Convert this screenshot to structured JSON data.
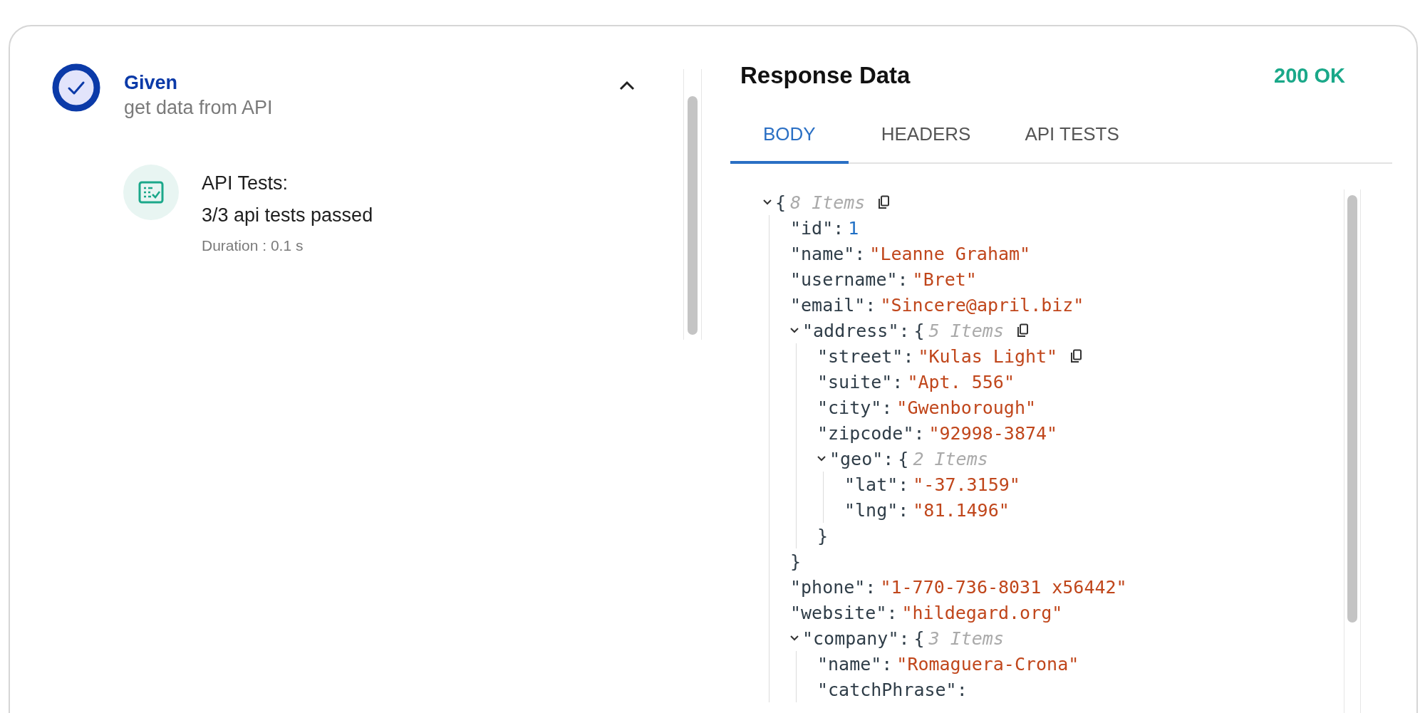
{
  "step": {
    "passed": true,
    "title": "Given",
    "subtitle": "get data from API",
    "expanded": true
  },
  "result": {
    "title": "API Tests:",
    "summary": "3/3 api tests passed",
    "duration": "Duration : 0.1 s"
  },
  "response": {
    "title": "Response Data",
    "status": "200 OK",
    "tabs": [
      {
        "label": "BODY",
        "selected": true
      },
      {
        "label": "HEADERS",
        "selected": false
      },
      {
        "label": "API TESTS",
        "selected": false
      }
    ],
    "tree": {
      "kind": "object",
      "open": "{",
      "count": "8 Items",
      "copy": true,
      "expanded": true,
      "children": [
        {
          "kind": "number",
          "key": "\"id\":",
          "value": "1"
        },
        {
          "kind": "string",
          "key": "\"name\":",
          "value": "\"Leanne Graham\""
        },
        {
          "kind": "string",
          "key": "\"username\":",
          "value": "\"Bret\""
        },
        {
          "kind": "string",
          "key": "\"email\":",
          "value": "\"Sincere@april.biz\""
        },
        {
          "kind": "object",
          "key": "\"address\":",
          "open": "{",
          "count": "5 Items",
          "copy": true,
          "expanded": true,
          "close": "}",
          "children": [
            {
              "kind": "string",
              "key": "\"street\":",
              "value": "\"Kulas Light\"",
              "copy": true
            },
            {
              "kind": "string",
              "key": "\"suite\":",
              "value": "\"Apt. 556\""
            },
            {
              "kind": "string",
              "key": "\"city\":",
              "value": "\"Gwenborough\""
            },
            {
              "kind": "string",
              "key": "\"zipcode\":",
              "value": "\"92998-3874\""
            },
            {
              "kind": "object",
              "key": "\"geo\":",
              "open": "{",
              "count": "2 Items",
              "expanded": true,
              "close": "}",
              "children": [
                {
                  "kind": "string",
                  "key": "\"lat\":",
                  "value": "\"-37.3159\""
                },
                {
                  "kind": "string",
                  "key": "\"lng\":",
                  "value": "\"81.1496\""
                }
              ]
            }
          ]
        },
        {
          "kind": "string",
          "key": "\"phone\":",
          "value": "\"1-770-736-8031 x56442\""
        },
        {
          "kind": "string",
          "key": "\"website\":",
          "value": "\"hildegard.org\""
        },
        {
          "kind": "object",
          "key": "\"company\":",
          "open": "{",
          "count": "3 Items",
          "expanded": true,
          "children": [
            {
              "kind": "string",
              "key": "\"name\":",
              "value": "\"Romaguera-Crona\""
            },
            {
              "kind": "string",
              "key": "\"catchPhrase\":"
            }
          ]
        }
      ]
    }
  }
}
